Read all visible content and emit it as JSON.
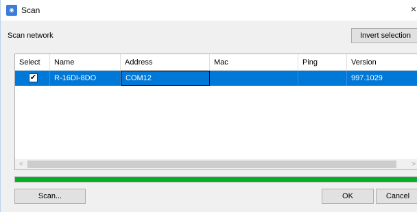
{
  "window": {
    "title": "Scan",
    "icon": "scan-app-icon",
    "close_glyph": "×"
  },
  "section_label": "Scan network",
  "buttons": {
    "invert_selection": "Invert selection",
    "scan": "Scan...",
    "ok": "OK",
    "cancel": "Cancel"
  },
  "table": {
    "columns": [
      "Select",
      "Name",
      "Address",
      "Mac",
      "Ping",
      "Version"
    ],
    "rows": [
      {
        "selected": true,
        "check_glyph": "✔",
        "name": "R-16DI-8DO",
        "address": "COM12",
        "mac": "",
        "ping": "",
        "version": "997.1029"
      }
    ]
  },
  "scrollbar": {
    "left_glyph": "<",
    "right_glyph": ">"
  },
  "progress": {
    "percent": 100,
    "color": "#06b025"
  },
  "colors": {
    "selection": "#0078d7",
    "button_bg": "#e1e1e1",
    "window_bg": "#f0f0f0"
  }
}
